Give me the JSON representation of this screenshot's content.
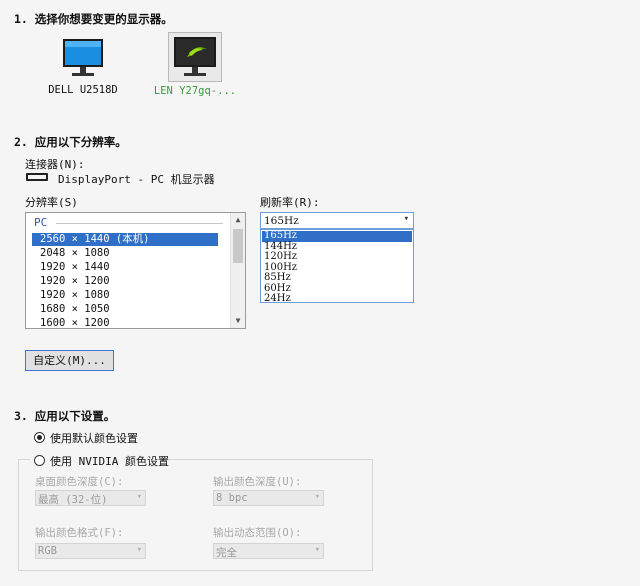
{
  "section1": {
    "title": "1. 选择你想要变更的显示器。"
  },
  "monitors": [
    {
      "label": "DELL U2518D",
      "icon": "monitor-icon",
      "selected": false
    },
    {
      "label": "LEN Y27gq-...",
      "icon": "monitor-nvidia-icon",
      "selected": true
    }
  ],
  "section2": {
    "title": "2. 应用以下分辨率。",
    "connector_label": "连接器(N):",
    "connector_value": "DisplayPort - PC 机显示器",
    "resolution_label": "分辨率(S)",
    "refresh_label": "刷新率(R):",
    "resolution_group": "PC",
    "resolutions": [
      "2560 × 1440 (本机)",
      "2048 × 1080",
      "1920 × 1440",
      "1920 × 1200",
      "1920 × 1080",
      "1680 × 1050",
      "1600 × 1200"
    ],
    "selected_resolution": 0,
    "refresh_selected": "165Hz",
    "refresh_options": [
      "165Hz",
      "144Hz",
      "120Hz",
      "100Hz",
      "85Hz",
      "60Hz",
      "24Hz"
    ],
    "customize_button": "自定义(M)..."
  },
  "section3": {
    "title": "3. 应用以下设置。",
    "radio_default": "使用默认颜色设置",
    "radio_nvidia": "使用 NVIDIA 颜色设置",
    "desktop_depth_label": "桌面颜色深度(C):",
    "desktop_depth_value": "最高 (32-位)",
    "output_depth_label": "输出颜色深度(U):",
    "output_depth_value": "8 bpc",
    "output_format_label": "输出颜色格式(F):",
    "output_format_value": "RGB",
    "output_range_label": "输出动态范围(O):",
    "output_range_value": "完全"
  },
  "colors": {
    "accent": "#2f6fc7",
    "selected_monitor_text": "#3a9a3a",
    "nvidia_green": "#76b900"
  }
}
